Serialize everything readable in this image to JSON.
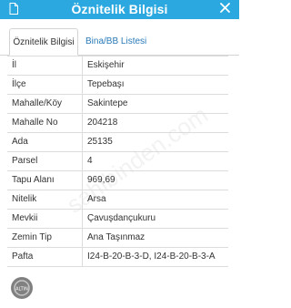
{
  "window": {
    "title": "Öznitelik Bilgisi",
    "close_icon": "close-icon",
    "doc_icon": "document-icon"
  },
  "tabs": [
    {
      "label": "Öznitelik Bilgisi",
      "active": true
    },
    {
      "label": "Bina/BB Listesi",
      "active": false
    }
  ],
  "rows": [
    {
      "label": "İl",
      "value": "Eskişehir"
    },
    {
      "label": "İlçe",
      "value": "Tepebaşı"
    },
    {
      "label": "Mahalle/Köy",
      "value": "Sakintepe"
    },
    {
      "label": "Mahalle No",
      "value": "204218"
    },
    {
      "label": "Ada",
      "value": "25135"
    },
    {
      "label": "Parsel",
      "value": "4"
    },
    {
      "label": "Tapu Alanı",
      "value": "969,69"
    },
    {
      "label": "Nitelik",
      "value": "Arsa"
    },
    {
      "label": "Mevkii",
      "value": "Çavuşdançukuru"
    },
    {
      "label": "Zemin Tip",
      "value": "Ana Taşınmaz"
    },
    {
      "label": "Pafta",
      "value": "I24-B-20-B-3-D, I24-B-20-B-3-A"
    }
  ],
  "watermark_text": "sahibinden.com",
  "logo_text": "ALTIN",
  "colors": {
    "titlebar": "#2aa8df",
    "tab_link": "#2a7ab8",
    "text": "#333333",
    "border": "#dcdcdc"
  }
}
